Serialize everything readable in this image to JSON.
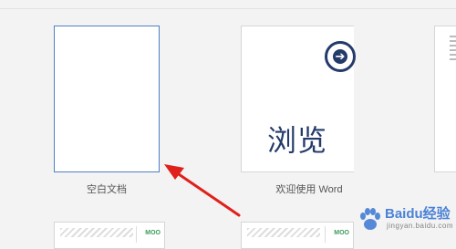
{
  "templates": [
    {
      "label": "空白文档"
    },
    {
      "label": "欢迎使用 Word",
      "preview_text": "浏览",
      "icon": "arrow-right-circle-icon"
    }
  ],
  "partial_templates": [
    {
      "badge": "MOO"
    },
    {
      "badge": "MOO"
    }
  ],
  "watermark": {
    "name": "Baidu经验",
    "sub": "jingyan.baidu.com"
  },
  "colors": {
    "accent": "#4f7fc4",
    "brand_navy": "#243b6a",
    "arrow": "#e0201b"
  }
}
